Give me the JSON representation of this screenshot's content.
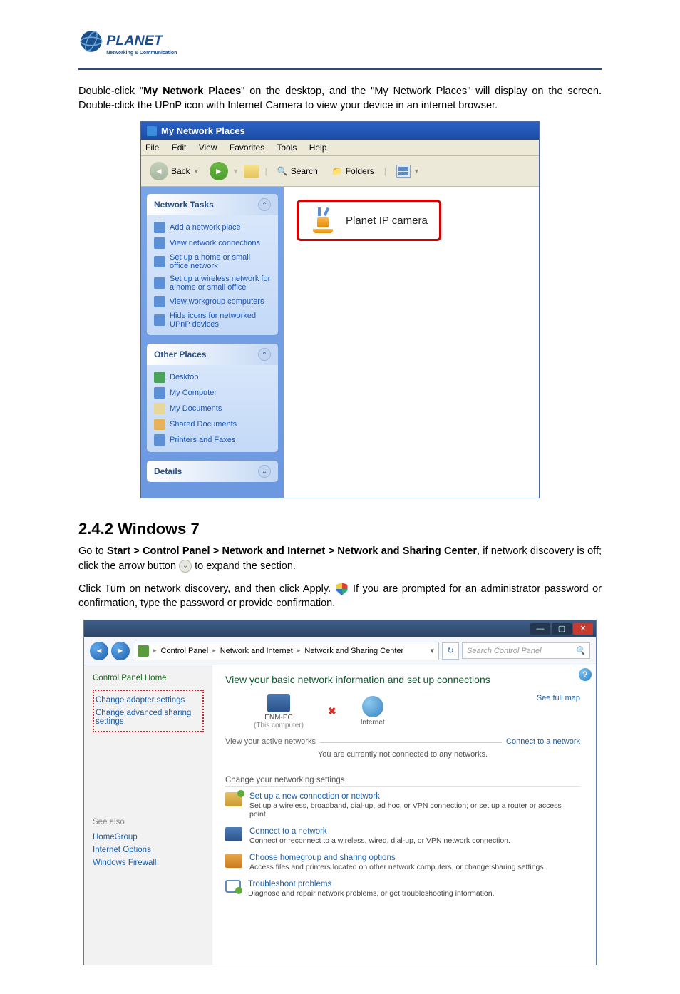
{
  "logo": {
    "brand_top": "PLANET",
    "brand_sub": "Networking & Communication"
  },
  "intro_text_1": "Double-click \"",
  "intro_bold": "My Network Places",
  "intro_text_2": "\" on the desktop, and the \"My Network Places\" will display on the screen. Double-click the UPnP icon with Internet Camera to view your device in an internet browser.",
  "xp": {
    "title": "My Network Places",
    "menu": [
      "File",
      "Edit",
      "View",
      "Favorites",
      "Tools",
      "Help"
    ],
    "toolbar": {
      "back": "Back",
      "search": "Search",
      "folders": "Folders"
    },
    "panel1": {
      "title": "Network Tasks",
      "items": [
        "Add a network place",
        "View network connections",
        "Set up a home or small office network",
        "Set up a wireless network for a home or small office",
        "View workgroup computers",
        "Hide icons for networked UPnP devices"
      ]
    },
    "panel2": {
      "title": "Other Places",
      "items": [
        "Desktop",
        "My Computer",
        "My Documents",
        "Shared Documents",
        "Printers and Faxes"
      ]
    },
    "panel3": {
      "title": "Details"
    },
    "callout": "Planet IP camera"
  },
  "heading": "2.4.2 Windows 7",
  "p1_a": "Go to ",
  "p1_b": "Start > Control Panel > Network and Internet > Network and Sharing Center",
  "p1_c": ", if network discovery is off; click the arrow button ",
  "p1_d": " to expand the section.",
  "p2_a": "Click Turn on network discovery, and then click Apply. ",
  "p2_b": " If you are prompted for an administrator password or confirmation, type the password or provide confirmation.",
  "win7": {
    "crumbs": [
      "Control Panel",
      "Network and Internet",
      "Network and Sharing Center"
    ],
    "search_placeholder": "Search Control Panel",
    "side": {
      "home": "Control Panel Home",
      "adapter": "Change adapter settings",
      "advanced": "Change advanced sharing settings",
      "see_also": "See also",
      "links": [
        "HomeGroup",
        "Internet Options",
        "Windows Firewall"
      ]
    },
    "main": {
      "h": "View your basic network information and set up connections",
      "pc_name": "ENM-PC",
      "pc_sub": "(This computer)",
      "internet": "Internet",
      "see_map": "See full map",
      "active_label": "View your active networks",
      "connect_link": "Connect to a network",
      "active_note": "You are currently not connected to any networks.",
      "change_h": "Change your networking settings",
      "opts": [
        {
          "t": "Set up a new connection or network",
          "d": "Set up a wireless, broadband, dial-up, ad hoc, or VPN connection; or set up a router or access point."
        },
        {
          "t": "Connect to a network",
          "d": "Connect or reconnect to a wireless, wired, dial-up, or VPN network connection."
        },
        {
          "t": "Choose homegroup and sharing options",
          "d": "Access files and printers located on other network computers, or change sharing settings."
        },
        {
          "t": "Troubleshoot problems",
          "d": "Diagnose and repair network problems, or get troubleshooting information."
        }
      ]
    }
  }
}
